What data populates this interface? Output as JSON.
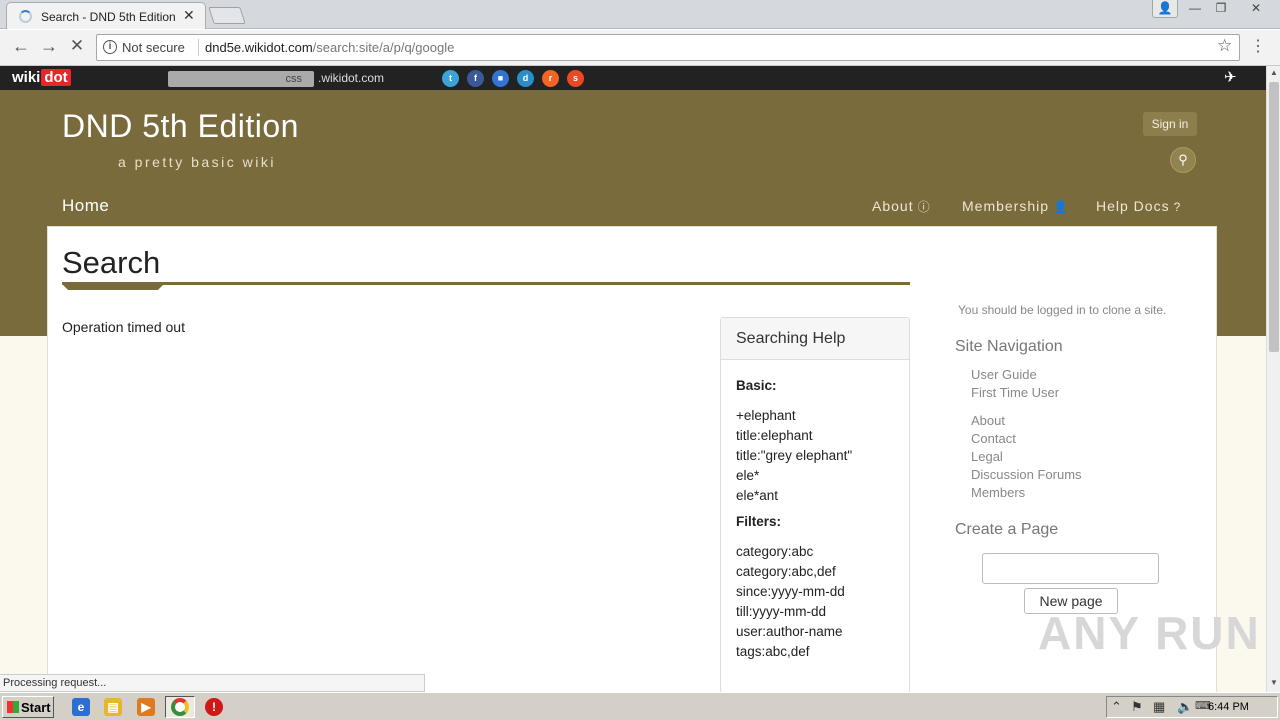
{
  "browser": {
    "tab_title": "Search - DND 5th Edition",
    "tab_close": "✕",
    "security_label": "Not secure",
    "url_host": "dnd5e.wikidot.com",
    "url_path": "/search:site/a/p/q/google"
  },
  "wikidot_bar": {
    "logo_wiki": "wiki",
    "logo_dot": "dot",
    "search_value": "css",
    "domain_suffix": ".wikidot.com",
    "social": [
      "twitter",
      "facebook",
      "delicious",
      "digg",
      "reddit",
      "stumbleupon"
    ]
  },
  "site": {
    "title": "DND 5th Edition",
    "subtitle": "a pretty basic wiki",
    "signin_label": "Sign in",
    "nav": {
      "home": "Home",
      "about": "About",
      "membership": "Membership",
      "help_docs": "Help Docs"
    }
  },
  "page": {
    "title": "Search",
    "message": "Operation timed out"
  },
  "help": {
    "heading": "Searching Help",
    "basic_label": "Basic:",
    "basic": [
      "+elephant",
      "title:elephant",
      "title:\"grey elephant\"",
      "ele*",
      "ele*ant"
    ],
    "filters_label": "Filters:",
    "filters": [
      "category:abc",
      "category:abc,def",
      "since:yyyy-mm-dd",
      "till:yyyy-mm-dd",
      "user:author-name",
      "tags:abc,def"
    ]
  },
  "sidebar": {
    "clone_notice": "You should be logged in to clone a site.",
    "nav_heading": "Site Navigation",
    "links_group1": [
      "User Guide",
      "First Time User"
    ],
    "links_group2": [
      "About",
      "Contact",
      "Legal",
      "Discussion Forums",
      "Members"
    ],
    "create_heading": "Create a Page",
    "new_page_label": "New page"
  },
  "status_text": "Processing request...",
  "watermark": "ANY RUN",
  "taskbar": {
    "start_label": "Start",
    "clock": "6:44 PM"
  }
}
